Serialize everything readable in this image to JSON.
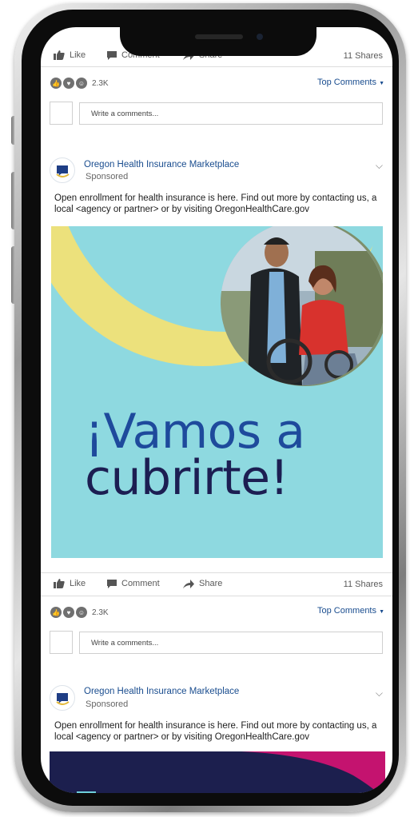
{
  "feed": {
    "actions": {
      "like": "Like",
      "comment": "Comment",
      "share": "Share"
    },
    "shares": "11 Shares",
    "reaction_count": "2.3K",
    "top_comments": "Top Comments",
    "comment_placeholder": "Write a comments...",
    "post": {
      "page_name": "Oregon Health Insurance Marketplace",
      "sponsored": "Sponsored",
      "text": "Open enrollment for health insurance is here. Find out more by contacting us, a local <agency or partner> or by visiting OregonHealthCare.gov"
    },
    "ad": {
      "headline_line1": "¡Vamos a",
      "headline_line2": "cubrirte!"
    }
  },
  "icons": [
    "thumbs-up-icon",
    "comment-icon",
    "share-arrow-icon",
    "like-reaction-icon",
    "love-reaction-icon",
    "laugh-reaction-icon",
    "chevron-down-icon",
    "oregon-logo"
  ],
  "colors": {
    "link_blue": "#1a4d8f",
    "ad_teal": "#8ed9e0",
    "ad_yellow": "#ece17c",
    "headline_blue": "#1e4a9c",
    "headline_navy": "#1c1e52",
    "ad2_magenta": "#c4136f",
    "ad2_navy": "#1c1f4e"
  }
}
